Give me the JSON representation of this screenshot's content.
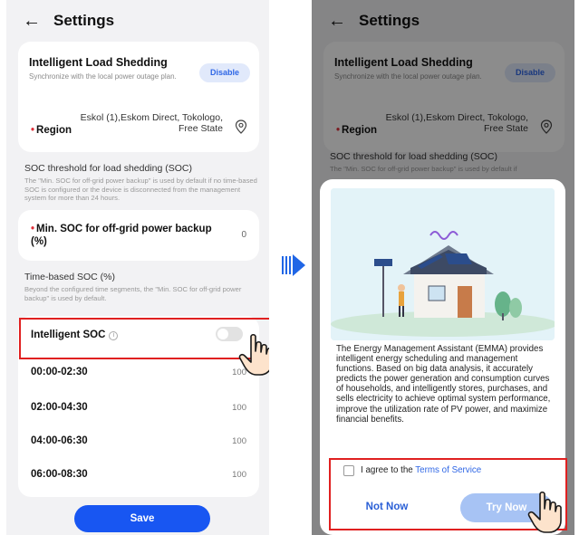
{
  "header": {
    "title": "Settings"
  },
  "load_shedding": {
    "title": "Intelligent Load Shedding",
    "subtitle": "Synchronize with the local power outage plan.",
    "disable_label": "Disable",
    "region_label": "Region",
    "region_value": "Eskol (1),Eskom Direct, Tokologo, Free State"
  },
  "soc_threshold": {
    "title": "SOC threshold for load shedding (SOC)",
    "description": "The \"Min. SOC for off-grid power backup\" is used by default if no time-based SOC is configured or the device is disconnected from the management system for more than 24 hours.",
    "description_short": "The \"Min. SOC for off-grid power backup\" is used by default if",
    "min_soc_label": "Min. SOC for off-grid power backup (%)",
    "min_soc_value": "0"
  },
  "time_based": {
    "title": "Time-based SOC (%)",
    "description": "Beyond the configured time segments, the \"Min. SOC for off-grid power backup\" is used by default."
  },
  "intelligent_soc": {
    "label": "Intelligent SOC",
    "enabled": false
  },
  "time_segments": [
    {
      "time": "00:00-02:30",
      "value": "100"
    },
    {
      "time": "02:00-04:30",
      "value": "100"
    },
    {
      "time": "04:00-06:30",
      "value": "100"
    },
    {
      "time": "06:00-08:30",
      "value": "100"
    }
  ],
  "save_label": "Save",
  "dialog": {
    "text": "The Energy Management Assistant (EMMA) provides intelligent energy scheduling and management functions. Based on big data analysis, it accurately predicts the power generation and consumption curves of households, and intelligently stores, purchases, and sells electricity to achieve optimal system performance, improve the utilization rate of PV power, and maximize financial benefits.",
    "agree_prefix": "I agree to the ",
    "terms_link": "Terms of Service",
    "not_now": "Not Now",
    "try_now": "Try Now"
  },
  "colors": {
    "accent": "#1856f2",
    "highlight": "#e02020",
    "required": "#e0323c"
  }
}
